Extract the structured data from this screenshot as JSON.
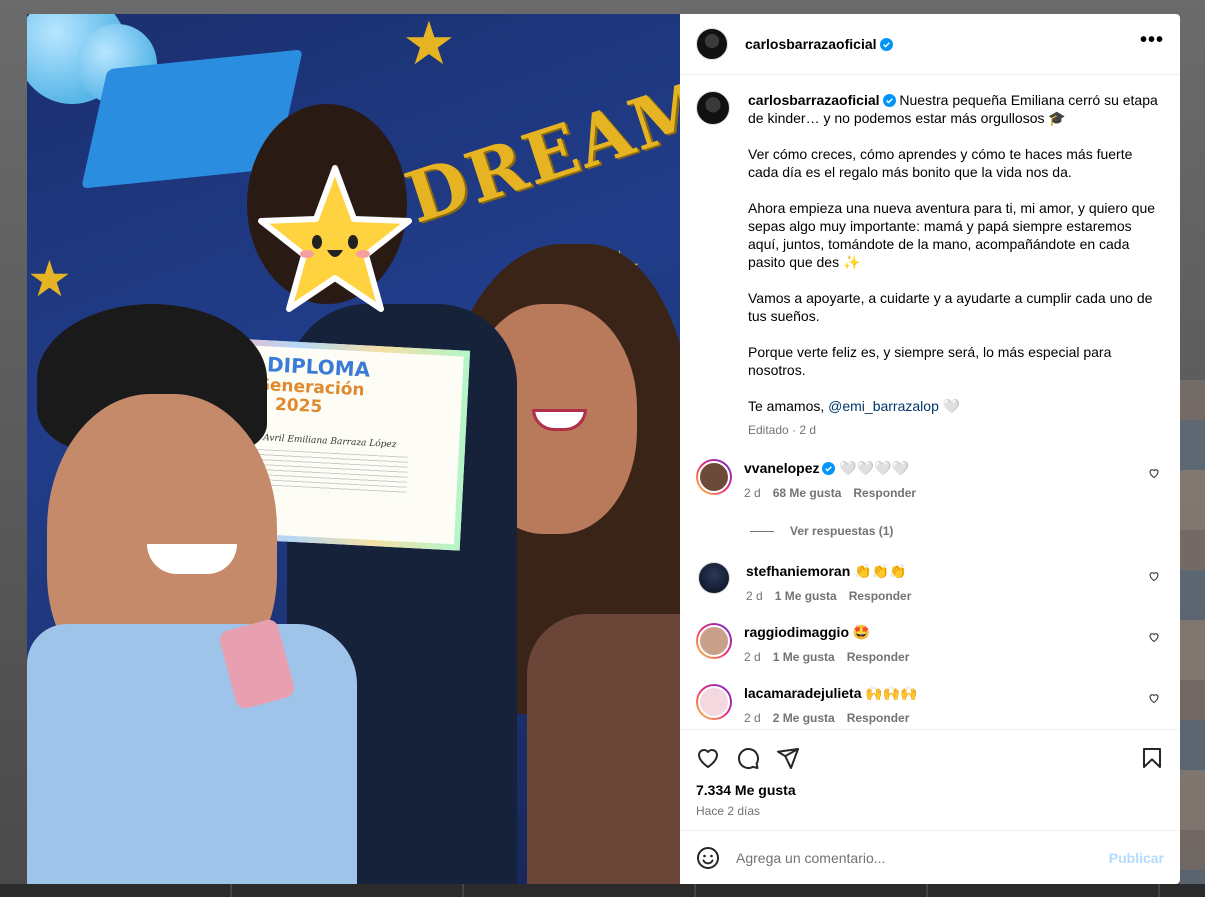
{
  "post": {
    "author": "carlosbarrazaoficial",
    "verified": true,
    "caption": {
      "intro": "Nuestra pequeña Emiliana cerró su etapa de kinder… y no podemos estar más orgullosos 🎓",
      "p2": "Ver cómo creces, cómo aprendes y cómo te haces más fuerte cada día es el regalo más bonito que la vida nos da.",
      "p3": "Ahora empieza una nueva aventura para ti, mi amor, y quiero que sepas algo muy importante: mamá y papá siempre estaremos aquí, juntos, tomándote de la mano, acompañándote en cada pasito que des ✨",
      "p4": "Vamos a apoyarte, a cuidarte y a ayudarte a cumplir cada uno de tus sueños.",
      "p5": "Porque verte feliz es, y siempre será, lo más especial para nosotros.",
      "p6_prefix": "Te amamos, ",
      "p6_mention": "@emi_barrazalop",
      "p6_suffix": " 🤍",
      "edited": "Editado",
      "age": "2 d"
    },
    "photo": {
      "diploma_title": "DIPLOMA",
      "diploma_sub1": "Generación",
      "diploma_sub2": "2025",
      "diploma_name": "Avril Emiliana Barraza López",
      "banner": "DREAMERS"
    }
  },
  "comments": [
    {
      "user": "vvanelopez",
      "verified": true,
      "text": "🤍🤍🤍🤍",
      "age": "2 d",
      "likes": "68 Me gusta",
      "reply": "Responder",
      "replies": "Ver respuestas (1)"
    },
    {
      "user": "stefhaniemoran",
      "verified": false,
      "text": "👏👏👏",
      "age": "2 d",
      "likes": "1 Me gusta",
      "reply": "Responder"
    },
    {
      "user": "raggiodimaggio",
      "verified": false,
      "text": "🤩",
      "age": "2 d",
      "likes": "1 Me gusta",
      "reply": "Responder"
    },
    {
      "user": "lacamaradejulieta",
      "verified": false,
      "text": "🙌🙌🙌",
      "age": "2 d",
      "likes": "2 Me gusta",
      "reply": "Responder"
    }
  ],
  "footer": {
    "likes": "7.334 Me gusta",
    "time": "Hace 2 días",
    "comment_placeholder": "Agrega un comentario...",
    "publish": "Publicar"
  },
  "icons": [
    "more-icon",
    "heart-icon",
    "comment-icon",
    "share-icon",
    "bookmark-icon",
    "emoji-icon",
    "verified-icon"
  ],
  "colors": {
    "verified": "#0095f6",
    "link": "#00376b",
    "publish": "#b3dbff",
    "muted": "#737373"
  }
}
